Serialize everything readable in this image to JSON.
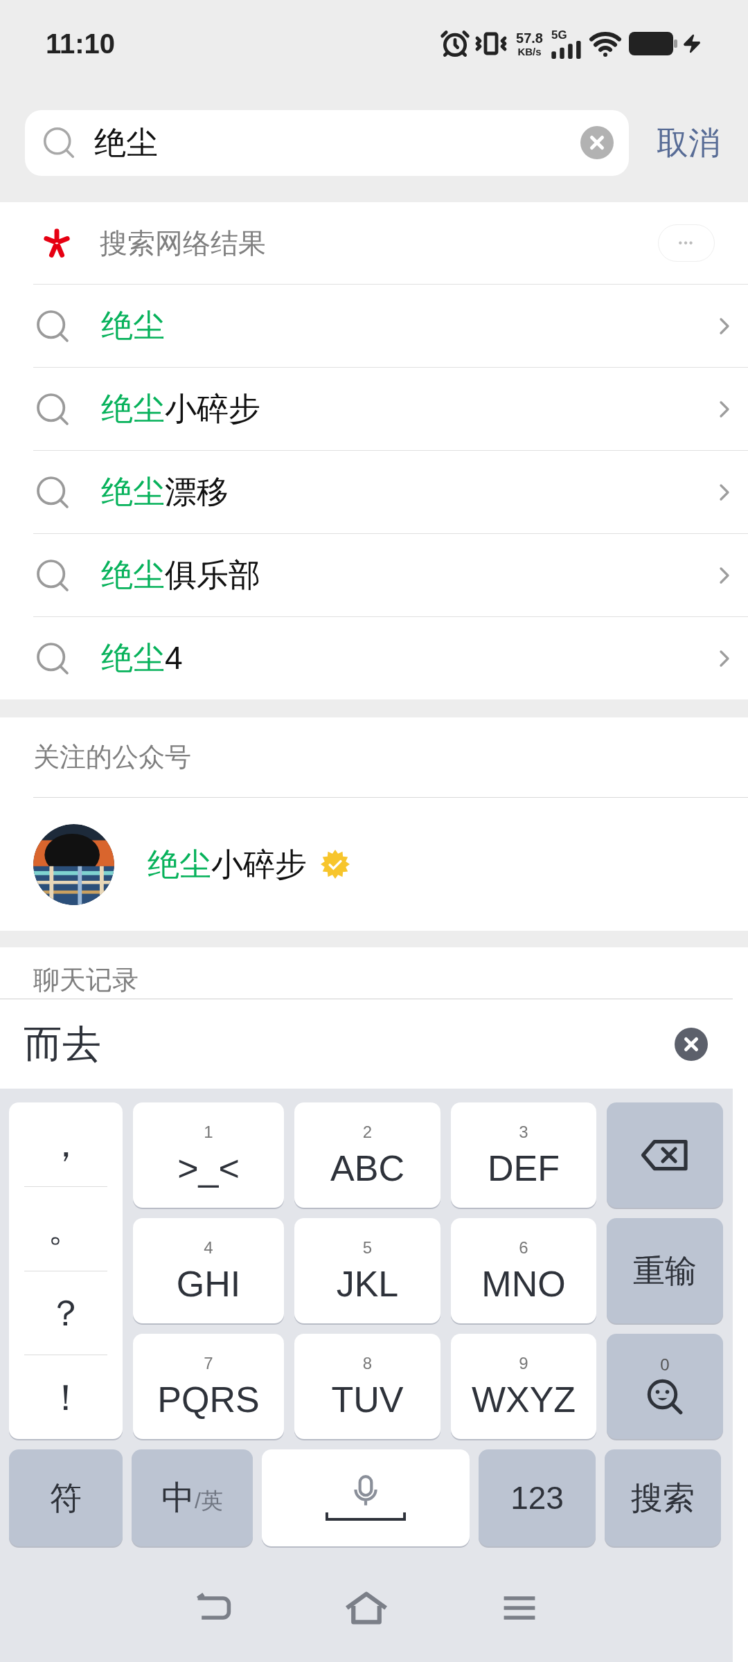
{
  "status_bar": {
    "time": "11:10",
    "net_speed": "57.8",
    "net_unit": "KB/s",
    "network": "5G"
  },
  "search": {
    "value": "绝尘",
    "cancel": "取消"
  },
  "web_results": {
    "title": "搜索网络结果",
    "more": "•••",
    "suggestions": [
      {
        "match": "绝尘"
      },
      {
        "match": "绝尘",
        "rest": "小碎步"
      },
      {
        "match": "绝尘",
        "rest": "漂移"
      },
      {
        "match": "绝尘",
        "rest": "俱乐部"
      },
      {
        "match": "绝尘",
        "rest": "4"
      }
    ]
  },
  "accounts": {
    "title": "关注的公众号",
    "items": [
      {
        "match": "绝尘",
        "rest": "小碎步",
        "verified": true
      }
    ]
  },
  "chat_history": {
    "title": "聊天记录"
  },
  "keyboard": {
    "candidate": "而去",
    "punctuation": [
      "，",
      "。",
      "？",
      "！"
    ],
    "keys": [
      {
        "kind": "letter",
        "digit": "1",
        "label": ">_<"
      },
      {
        "kind": "letter",
        "digit": "2",
        "label": "ABC"
      },
      {
        "kind": "letter",
        "digit": "3",
        "label": "DEF"
      },
      {
        "kind": "backspace"
      },
      {
        "kind": "letter",
        "digit": "4",
        "label": "GHI"
      },
      {
        "kind": "letter",
        "digit": "5",
        "label": "JKL"
      },
      {
        "kind": "letter",
        "digit": "6",
        "label": "MNO"
      },
      {
        "kind": "function",
        "label": "重输"
      },
      {
        "kind": "letter",
        "digit": "7",
        "label": "PQRS"
      },
      {
        "kind": "letter",
        "digit": "8",
        "label": "TUV"
      },
      {
        "kind": "letter",
        "digit": "9",
        "label": "WXYZ"
      },
      {
        "kind": "emoji",
        "digit": "0"
      }
    ],
    "bottom_row": [
      {
        "kind": "function",
        "label": "符"
      },
      {
        "kind": "language",
        "label": "中",
        "alt": "/英"
      },
      {
        "kind": "space"
      },
      {
        "kind": "function",
        "label": "123"
      },
      {
        "kind": "function",
        "label": "搜索"
      }
    ]
  }
}
